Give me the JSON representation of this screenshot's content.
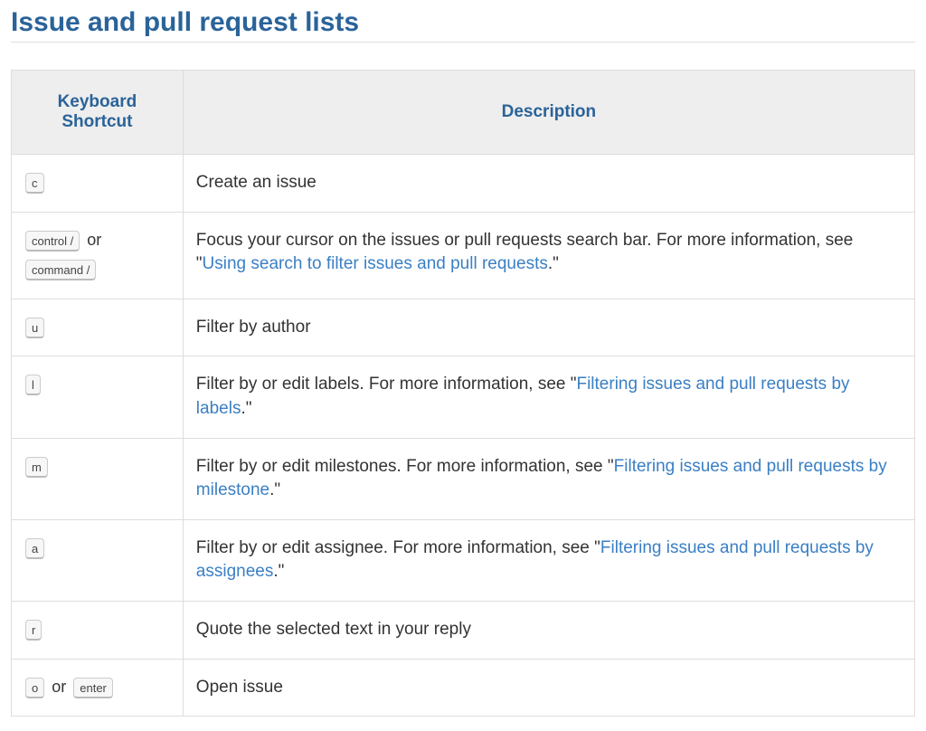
{
  "title": "Issue and pull request lists",
  "table": {
    "headers": {
      "shortcut": "Keyboard Shortcut",
      "description": "Description"
    },
    "or_label": "or",
    "rows": [
      {
        "keys_line1": [
          {
            "label": "c"
          }
        ],
        "keys_line1_or": false,
        "keys_line2": [],
        "desc_prefix": "Create an issue",
        "link_text": "",
        "desc_suffix": ""
      },
      {
        "keys_line1": [
          {
            "label": "control /"
          }
        ],
        "keys_line1_or": true,
        "keys_line2": [
          {
            "label": "command /"
          }
        ],
        "desc_prefix": "Focus your cursor on the issues or pull requests search bar. For more information, see \"",
        "link_text": "Using search to filter issues and pull requests",
        "desc_suffix": ".\""
      },
      {
        "keys_line1": [
          {
            "label": "u"
          }
        ],
        "keys_line1_or": false,
        "keys_line2": [],
        "desc_prefix": "Filter by author",
        "link_text": "",
        "desc_suffix": ""
      },
      {
        "keys_line1": [
          {
            "label": "l"
          }
        ],
        "keys_line1_or": false,
        "keys_line2": [],
        "desc_prefix": "Filter by or edit labels. For more information, see \"",
        "link_text": "Filtering issues and pull requests by labels",
        "desc_suffix": ".\""
      },
      {
        "keys_line1": [
          {
            "label": "m"
          }
        ],
        "keys_line1_or": false,
        "keys_line2": [],
        "desc_prefix": "Filter by or edit milestones. For more information, see \"",
        "link_text": "Filtering issues and pull requests by milestone",
        "desc_suffix": ".\""
      },
      {
        "keys_line1": [
          {
            "label": "a"
          }
        ],
        "keys_line1_or": false,
        "keys_line2": [],
        "desc_prefix": "Filter by or edit assignee. For more information, see \"",
        "link_text": "Filtering issues and pull requests by assignees",
        "desc_suffix": ".\""
      },
      {
        "keys_line1": [
          {
            "label": "r"
          }
        ],
        "keys_line1_or": false,
        "keys_line2": [],
        "desc_prefix": "Quote the selected text in your reply",
        "link_text": "",
        "desc_suffix": ""
      },
      {
        "keys_line1": [
          {
            "label": "o"
          }
        ],
        "keys_line1_or": true,
        "keys_line2_inline": [
          {
            "label": "enter"
          }
        ],
        "keys_line2": [],
        "desc_prefix": "Open issue",
        "link_text": "",
        "desc_suffix": ""
      }
    ]
  }
}
